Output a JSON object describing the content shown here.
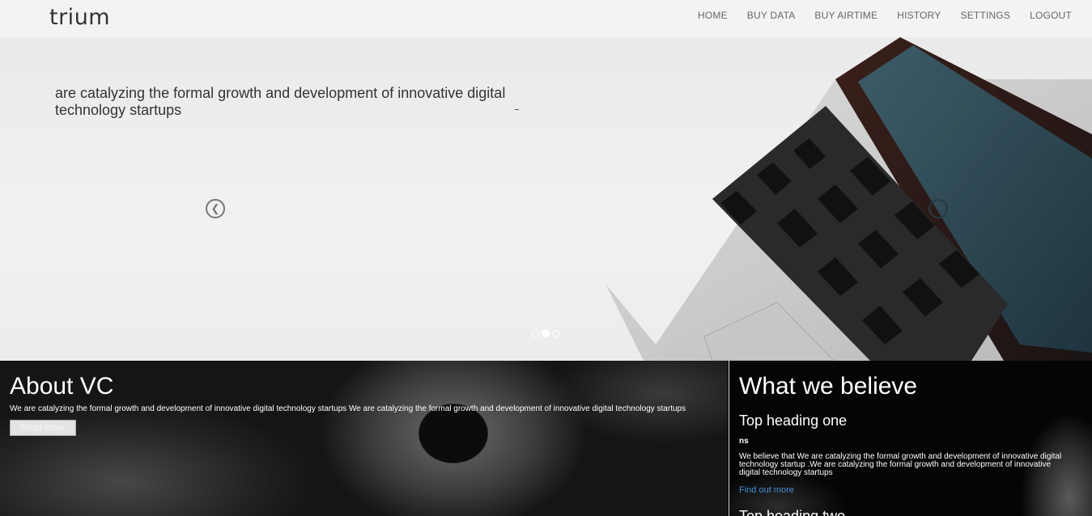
{
  "header": {
    "brand": "trium",
    "nav": [
      "HOME",
      "BUY DATA",
      "BUY AIRTIME",
      "HISTORY",
      "SETTINGS",
      "LOGOUT"
    ]
  },
  "hero": {
    "caption": "are catalyzing the formal growth and development of innovative digital technology startups",
    "slides_total": 3,
    "active_slide": 2
  },
  "about": {
    "title": "About VC",
    "text": "We are catalyzing the formal growth and development of innovative digital technology startups We are catalyzing the formal growth and development of innovative digital technology startups",
    "button": "Read More"
  },
  "believe": {
    "title": "What we believe",
    "heading_one": "Top heading one",
    "short": "ns",
    "body": "We believe that We are catalyzing the formal growth and development of innovative digital technology startup .We are catalyzing the formal growth and development of innovative digital technology startups",
    "link": "Find out more",
    "heading_two": "Top heading two"
  },
  "colors": {
    "link": "#3f8fd8",
    "header_bg": "#f3f3f3"
  }
}
